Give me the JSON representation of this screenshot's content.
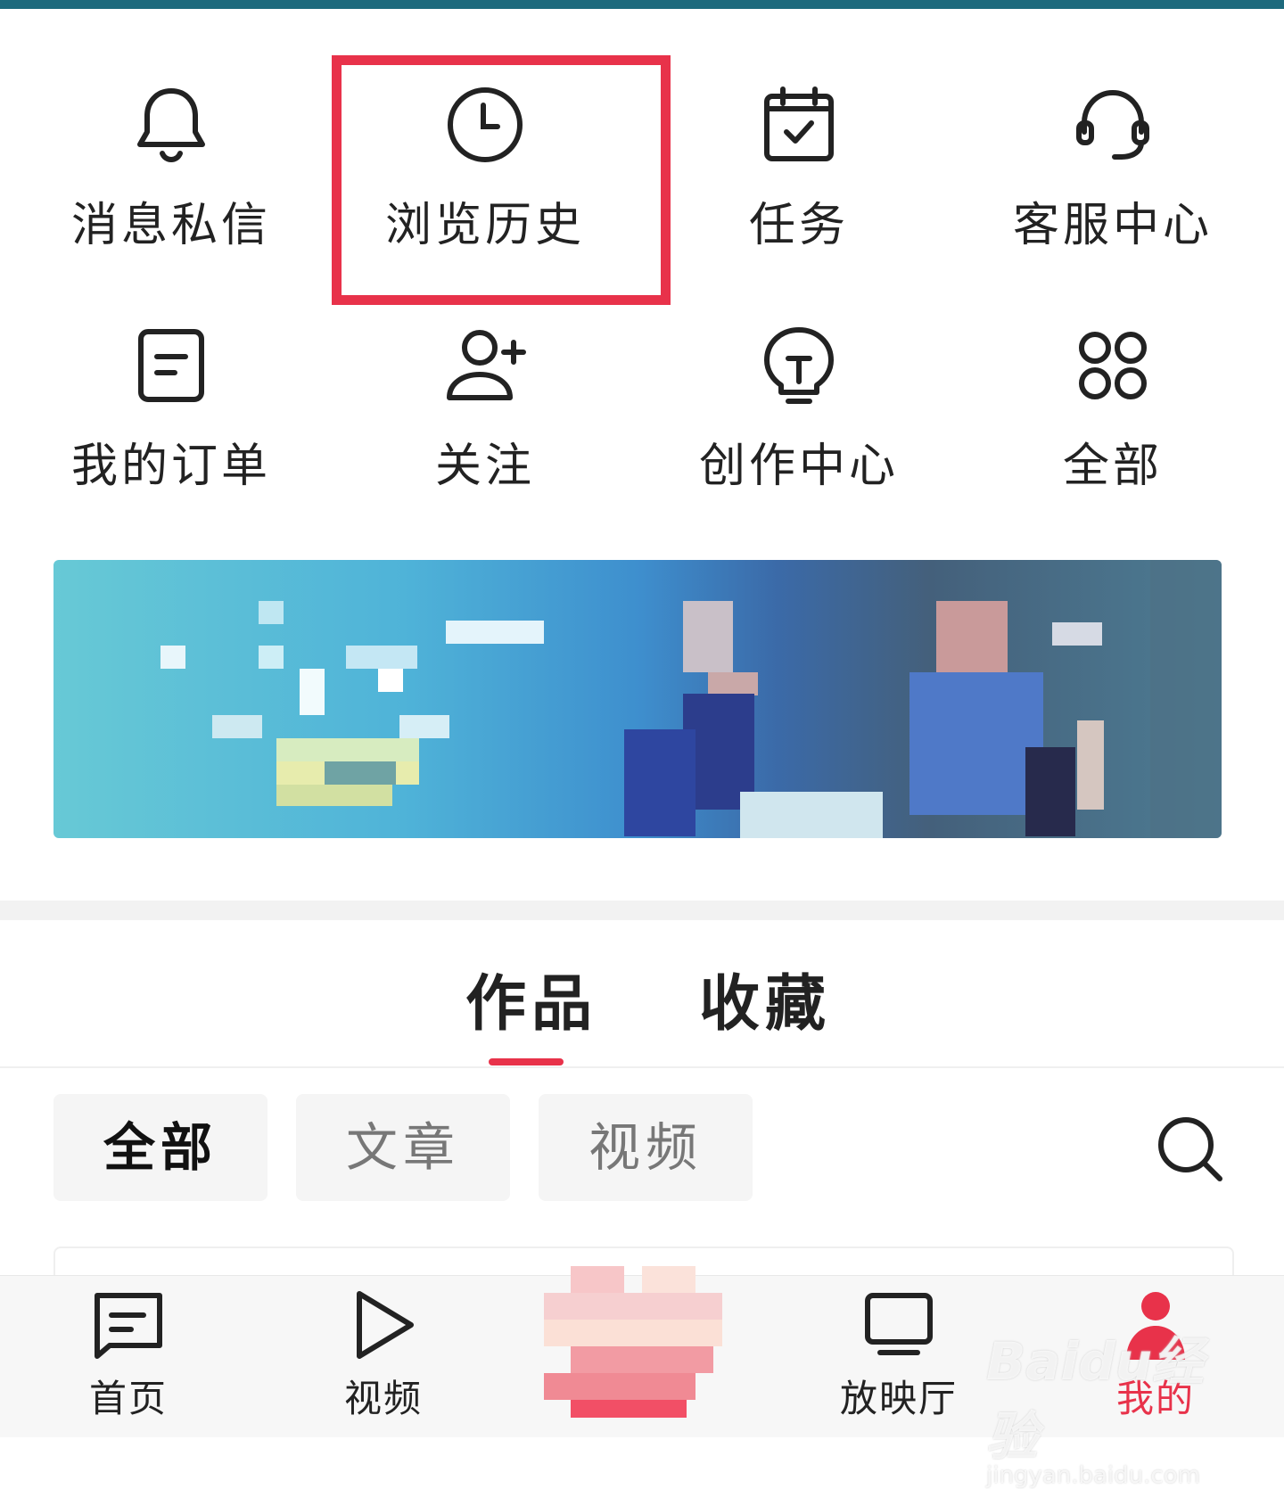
{
  "quick_actions": [
    {
      "label": "消息私信",
      "icon": "bell-icon"
    },
    {
      "label": "浏览历史",
      "icon": "clock-icon",
      "highlighted": true
    },
    {
      "label": "任务",
      "icon": "calendar-check-icon"
    },
    {
      "label": "客服中心",
      "icon": "headset-icon"
    },
    {
      "label": "我的订单",
      "icon": "order-icon"
    },
    {
      "label": "关注",
      "icon": "user-plus-icon"
    },
    {
      "label": "创作中心",
      "icon": "lightbulb-icon"
    },
    {
      "label": "全部",
      "icon": "grid-icon"
    }
  ],
  "tabs": [
    {
      "label": "作品",
      "active": true
    },
    {
      "label": "收藏",
      "active": false
    }
  ],
  "filters": [
    {
      "label": "全部",
      "active": true
    },
    {
      "label": "文章",
      "active": false
    },
    {
      "label": "视频",
      "active": false
    }
  ],
  "bottom_nav": [
    {
      "label": "首页",
      "icon": "home-icon"
    },
    {
      "label": "视频",
      "icon": "play-icon"
    },
    {
      "label": "放映厅",
      "icon": "tv-icon"
    },
    {
      "label": "我的",
      "icon": "profile-icon",
      "active": true
    }
  ],
  "watermark": {
    "text": "Baidu经验",
    "sub": "jingyan.baidu.com"
  },
  "colors": {
    "accent": "#e8324a",
    "highlight_border": "#e8324a",
    "top_strip": "#1d6a7d"
  }
}
